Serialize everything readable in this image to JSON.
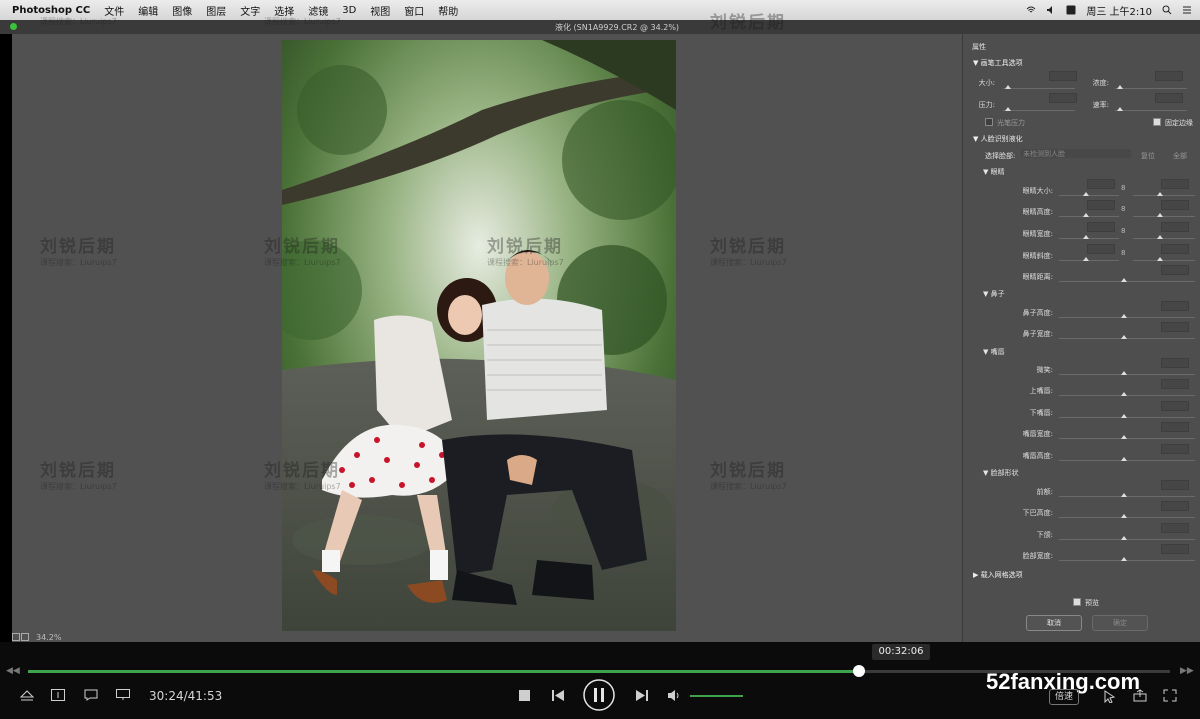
{
  "menubar": {
    "app_name": "Photoshop CC",
    "items": [
      "文件",
      "编辑",
      "图像",
      "图层",
      "文字",
      "选择",
      "滤镜",
      "3D",
      "视图",
      "窗口",
      "帮助"
    ],
    "clock": "周三 上午2:10"
  },
  "document": {
    "tab_title": "液化 (SN1A9929.CR2 @ 34.2%)",
    "zoom": "34.2%"
  },
  "watermark": {
    "logo": "刘锐后期",
    "subtitle": "课程搜索：Liuruips7"
  },
  "panel": {
    "title": "属性",
    "brush_section": "画笔工具选项",
    "brush_size": "大小:",
    "brush_density": "浓度:",
    "brush_pressure": "压力:",
    "brush_rate": "速率:",
    "stylus_pressure": "光笔压力",
    "pin_edges": "固定边缘",
    "face_section": "人脸识别液化",
    "select_face_label": "选择脸部:",
    "select_face_value": "未检测到人脸",
    "reset": "复位",
    "all": "全部",
    "eyes_section": "眼睛",
    "eyes": [
      "眼睛大小:",
      "眼睛高度:",
      "眼睛宽度:",
      "眼睛斜度:",
      "眼睛距离:"
    ],
    "nose_section": "鼻子",
    "nose": [
      "鼻子高度:",
      "鼻子宽度:"
    ],
    "mouth_section": "嘴唇",
    "mouth": [
      "微笑:",
      "上嘴唇:",
      "下嘴唇:",
      "嘴唇宽度:",
      "嘴唇高度:"
    ],
    "face_shape_section": "脸部形状",
    "face_shape": [
      "前额:",
      "下巴高度:",
      "下颌:",
      "脸部宽度:"
    ],
    "mesh_section": "载入网格选项",
    "preview": "预览",
    "cancel": "取消",
    "ok": "确定"
  },
  "player": {
    "hover_time": "00:32:06",
    "current_time": "30:24/41:53",
    "progress": 0.728,
    "volume": 1.0,
    "speed_label": "倍速",
    "site": "52fanxing.com",
    "skip_back": "◀◀",
    "skip_forward": "▶▶"
  }
}
